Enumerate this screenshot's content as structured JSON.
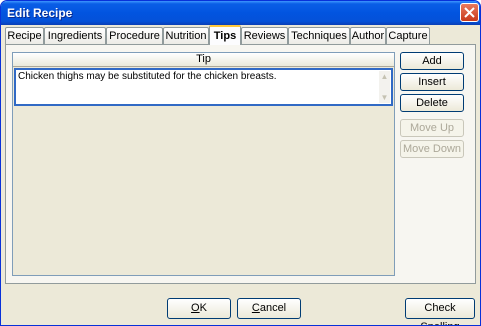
{
  "window": {
    "title": "Edit Recipe"
  },
  "tabs": [
    {
      "label": "Recipe"
    },
    {
      "label": "Ingredients"
    },
    {
      "label": "Procedure"
    },
    {
      "label": "Nutrition"
    },
    {
      "label": "Tips",
      "active": true
    },
    {
      "label": "Reviews"
    },
    {
      "label": "Techniques"
    },
    {
      "label": "Author"
    },
    {
      "label": "Capture"
    }
  ],
  "tips": {
    "column_header": "Tip",
    "rows": [
      "Chicken thighs may be substituted for the chicken breasts."
    ]
  },
  "side_buttons": {
    "add": "Add",
    "insert": "Insert",
    "delete": "Delete",
    "move_up": "Move Up",
    "move_down": "Move Down"
  },
  "footer": {
    "ok_mnemonic": "O",
    "ok_rest": "K",
    "cancel_mnemonic": "C",
    "cancel_rest": "ancel",
    "check_spelling": "Check Spelling"
  },
  "colors": {
    "titlebar": "#0254e0",
    "selection_border": "#316ac5",
    "active_tab_accent": "#ffc83c"
  },
  "icons": {
    "close": "close-icon"
  }
}
